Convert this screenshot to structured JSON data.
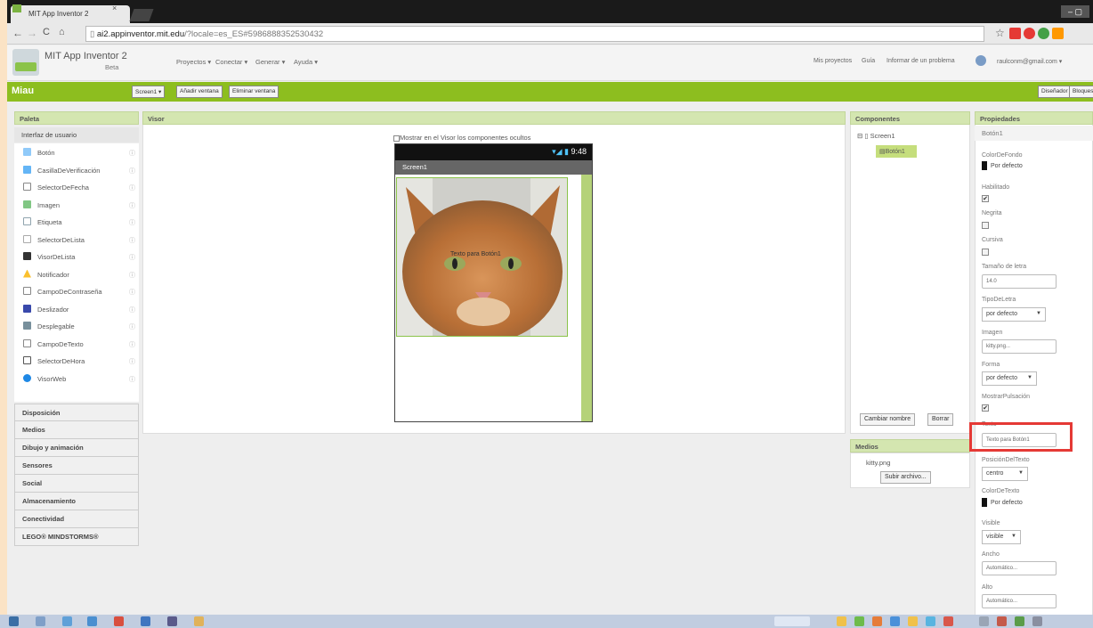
{
  "browser": {
    "tab_title": "MIT App Inventor 2",
    "tab_close": "×",
    "window_controls": "– ▢",
    "url_host": "ai2.appinventor.mit.edu",
    "url_rest": "/?locale=es_ES#5986888352530432"
  },
  "header": {
    "title": "MIT App Inventor 2",
    "beta": "Beta",
    "menu": [
      "Proyectos ▾",
      "Conectar ▾",
      "Generar ▾",
      "Ayuda ▾"
    ],
    "right_menu": [
      "Mis proyectos",
      "Guía",
      "Informar de un problema"
    ],
    "user": "raulconm@gmail.com ▾"
  },
  "project_bar": {
    "project_name": "Miau",
    "screen_button": "Screen1 ▾",
    "add_window": "Añadir ventana",
    "remove_window": "Eliminar ventana",
    "designer": "Diseñador",
    "blocks": "Bloques"
  },
  "palette": {
    "title": "Paleta",
    "category": "Interfaz de usuario",
    "help": "ⓘ",
    "items": [
      "Botón",
      "CasillaDeVerificación",
      "SelectorDeFecha",
      "Imagen",
      "Etiqueta",
      "SelectorDeLista",
      "VisorDeLista",
      "Notificador",
      "CampoDeContraseña",
      "Deslizador",
      "Desplegable",
      "CampoDeTexto",
      "SelectorDeHora",
      "VisorWeb"
    ],
    "categories": [
      "Disposición",
      "Medios",
      "Dibujo y animación",
      "Sensores",
      "Social",
      "Almacenamiento",
      "Conectividad",
      "LEGO® MINDSTORMS®"
    ]
  },
  "viewer": {
    "title": "Visor",
    "show_hidden": "Mostrar en el Visor los componentes ocultos",
    "time": "9:48",
    "screen_title": "Screen1",
    "button_text": "Texto para Botón1"
  },
  "components": {
    "title": "Componentes",
    "screen": "Screen1",
    "button": "Botón1",
    "rename": "Cambiar nombre",
    "delete": "Borrar"
  },
  "media": {
    "title": "Medios",
    "file": "kitty.png",
    "upload": "Subir archivo..."
  },
  "properties": {
    "title": "Propiedades",
    "component": "Botón1",
    "bg_color_label": "ColorDeFondo",
    "bg_color_value": "Por defecto",
    "enabled_label": "Habilitado",
    "bold_label": "Negrita",
    "italic_label": "Cursiva",
    "font_size_label": "Tamaño de letra",
    "font_size_value": "14.0",
    "font_type_label": "TipoDeLetra",
    "font_type_value": "por defecto",
    "image_label": "Imagen",
    "image_value": "kitty.png...",
    "shape_label": "Forma",
    "shape_value": "por defecto",
    "show_feedback_label": "MostrarPulsación",
    "text_label": "Texto",
    "text_value": "Texto para Botón1",
    "text_align_label": "PosiciónDelTexto",
    "text_align_value": "centro",
    "text_color_label": "ColorDeTexto",
    "text_color_value": "Por defecto",
    "visible_label": "Visible",
    "visible_value": "visible",
    "width_label": "Ancho",
    "width_value": "Automático...",
    "height_label": "Alto",
    "height_value": "Automático...",
    "checked_mark": "✔",
    "select_arrow": "▼"
  },
  "colors": {
    "accent_green": "#8dbe1f",
    "panel_head": "#d4e6b0",
    "highlight_red": "#e53935"
  }
}
